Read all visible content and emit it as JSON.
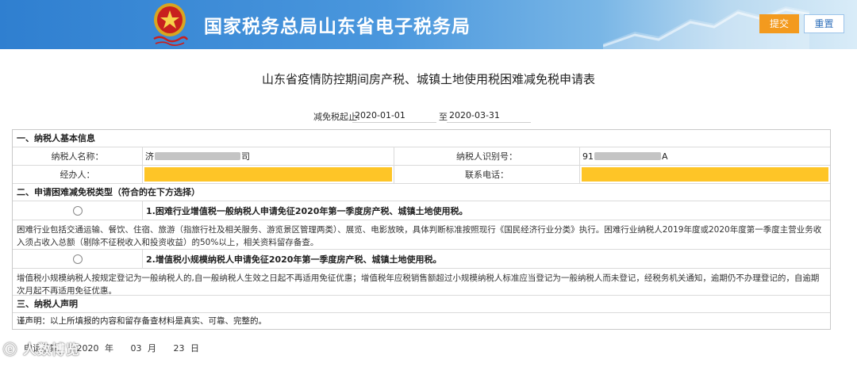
{
  "header": {
    "title": "国家税务总局山东省电子税务局",
    "submit_label": "提交",
    "reset_label": "重置",
    "colors": {
      "brand_blue": "#2f7fd0",
      "submit": "#f39a1e",
      "highlight": "#fec527"
    }
  },
  "form_title": "山东省疫情防控期间房产税、城镇土地使用税困难减免税申请表",
  "period": {
    "label": "减免税起止:",
    "start": "2020-01-01",
    "separator": "至",
    "end": "2020-03-31"
  },
  "sections": {
    "basic_info": "一、纳税人基本信息",
    "apply_type": "二、申请困难减免税类型（符合的在下方选择）",
    "declaration": "三、纳税人声明"
  },
  "basic_info": {
    "name_label": "纳税人名称：",
    "name_prefix": "济",
    "name_suffix": "司",
    "id_label": "纳税人识别号：",
    "id_prefix": "91",
    "id_suffix": "A",
    "agent_label": "经办人：",
    "phone_label": "联系电话："
  },
  "options": [
    {
      "title": "1.困难行业增值税一般纳税人申请免征2020年第一季度房产税、城镇土地使用税。",
      "description": "困难行业包括交通运输、餐饮、住宿、旅游（指旅行社及相关服务、游览景区管理两类）、展览、电影放映，具体判断标准按照现行《国民经济行业分类》执行。困难行业纳税人2019年度或2020年度第一季度主营业务收入须占收入总额（剔除不征税收入和投资收益）的50%以上，相关资料留存备查。"
    },
    {
      "title": "2.增值税小规模纳税人申请免征2020年第一季度房产税、城镇土地使用税。",
      "description": "增值税小规模纳税人按规定登记为一般纳税人的,自一般纳税人生效之日起不再适用免征优惠；增值税年应税销售额超过小规模纳税人标准应当登记为一般纳税人而未登记，经税务机关通知，逾期仍不办理登记的，自逾期次月起不再适用免征优惠。"
    }
  ],
  "declaration_text": "谨声明：以上所填报的内容和留存备查材料是真实、可靠、完整的。",
  "date": {
    "label": "申请日期：",
    "year": "2020",
    "year_unit": "年",
    "month": "03",
    "month_unit": "月",
    "day": "23",
    "day_unit": "日"
  },
  "watermark": "人数博览"
}
